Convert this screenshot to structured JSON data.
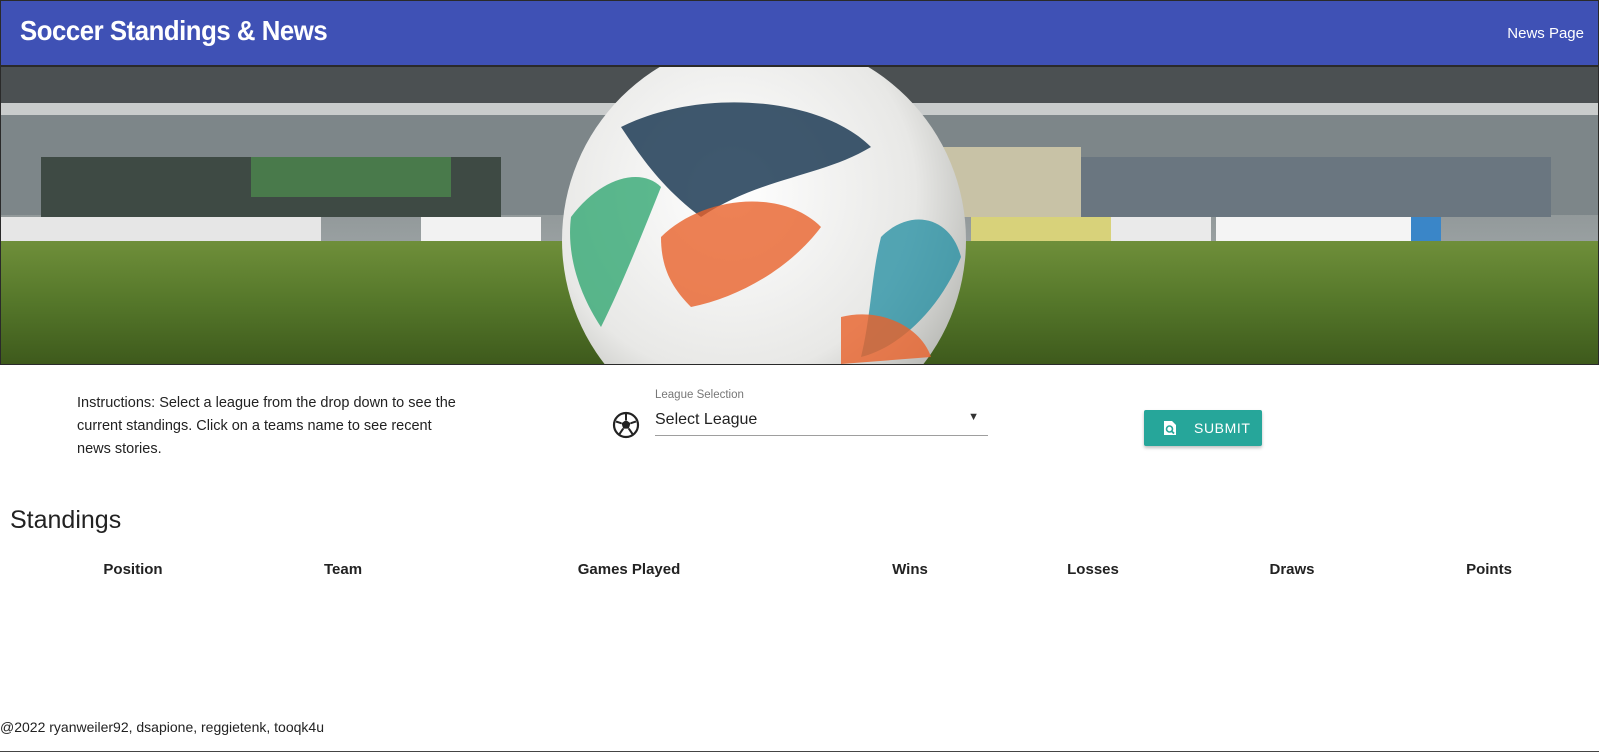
{
  "nav": {
    "brand": "Soccer Standings & News",
    "link_label": "News Page"
  },
  "hero": {
    "image": "soccer-ball-on-stadium-pitch"
  },
  "instructions": {
    "text": "Instructions: Select a league from the drop down to see the current standings. Click on a teams name to see recent news stories."
  },
  "league_select": {
    "label": "League Selection",
    "value": "Select League",
    "icon": "soccer-ball-icon"
  },
  "submit": {
    "label": "SUBMIT",
    "icon": "search-icon"
  },
  "standings": {
    "title": "Standings",
    "columns": [
      "Position",
      "Team",
      "Games Played",
      "Wins",
      "Losses",
      "Draws",
      "Points"
    ],
    "rows": []
  },
  "footer": {
    "text": "@2022 ryanweiler92, dsapione, reggietenk, tooqk4u"
  },
  "colors": {
    "navbar": "#3f51b5",
    "submit": "#26a69a"
  }
}
